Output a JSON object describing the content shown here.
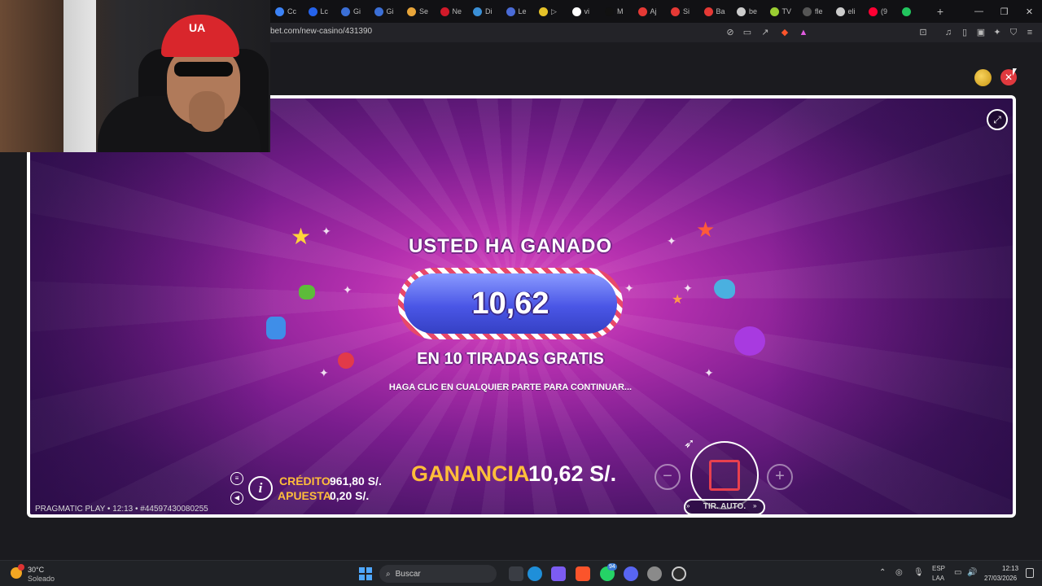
{
  "browser": {
    "tabs": [
      {
        "label": "Cc",
        "color": "#3b82f6"
      },
      {
        "label": "Lc",
        "color": "#2563eb"
      },
      {
        "label": "Gi",
        "color": "#3b6fd6"
      },
      {
        "label": "Gi",
        "color": "#3b6fd6"
      },
      {
        "label": "Se",
        "color": "#e8a53a"
      },
      {
        "label": "Ne",
        "color": "#d11a2a"
      },
      {
        "label": "Di",
        "color": "#3a8fd6"
      },
      {
        "label": "Le",
        "color": "#4a6bd6"
      },
      {
        "label": "▷",
        "color": "#e5c229"
      },
      {
        "label": "vi",
        "color": "#ffffff"
      },
      {
        "label": "M",
        "color": "#111111"
      },
      {
        "label": "Aj",
        "color": "#e53935"
      },
      {
        "label": "Si",
        "color": "#e53935"
      },
      {
        "label": "Ba",
        "color": "#e53935"
      },
      {
        "label": "be",
        "color": "#cccccc"
      },
      {
        "label": "TV",
        "color": "#9acd32"
      },
      {
        "label": "fle",
        "color": "#555555"
      },
      {
        "label": "eli",
        "color": "#cccccc"
      },
      {
        "label": "(9",
        "color": "#ff0033"
      },
      {
        "label": "",
        "color": "#22c55e"
      }
    ],
    "new_tab": "+",
    "window_controls": {
      "minimize": "—",
      "restore": "❐",
      "close": "✕"
    },
    "url": "bet.com/new-casino/431390"
  },
  "game": {
    "win_title": "USTED HA GANADO",
    "win_amount": "10,62",
    "free_spins_text": "EN 10 TIRADAS GRATIS",
    "continue_text": "HAGA CLIC EN CUALQUIER PARTE PARA CONTINUAR...",
    "credit_label": "CRÉDITO",
    "credit_value": "961,80 S/.",
    "bet_label": "APUESTA",
    "bet_value": "0,20 S/.",
    "win_label": "GANANCIA",
    "win_value": "10,62 S/.",
    "minus": "−",
    "plus": "+",
    "autospin_label": "TIR. AUTO.",
    "footer": "PRAGMATIC PLAY • 12:13 • #44597430080255",
    "info": "i"
  },
  "site": {
    "close": "✕"
  },
  "webcam": {
    "cap_logo": "UA"
  },
  "taskbar": {
    "temperature": "30°C",
    "weather": "Soleado",
    "search_placeholder": "Buscar",
    "chat_badge": "94",
    "lang_top": "ESP",
    "lang_bottom": "LAA",
    "time": "12:13",
    "date": "27/03/2026"
  }
}
